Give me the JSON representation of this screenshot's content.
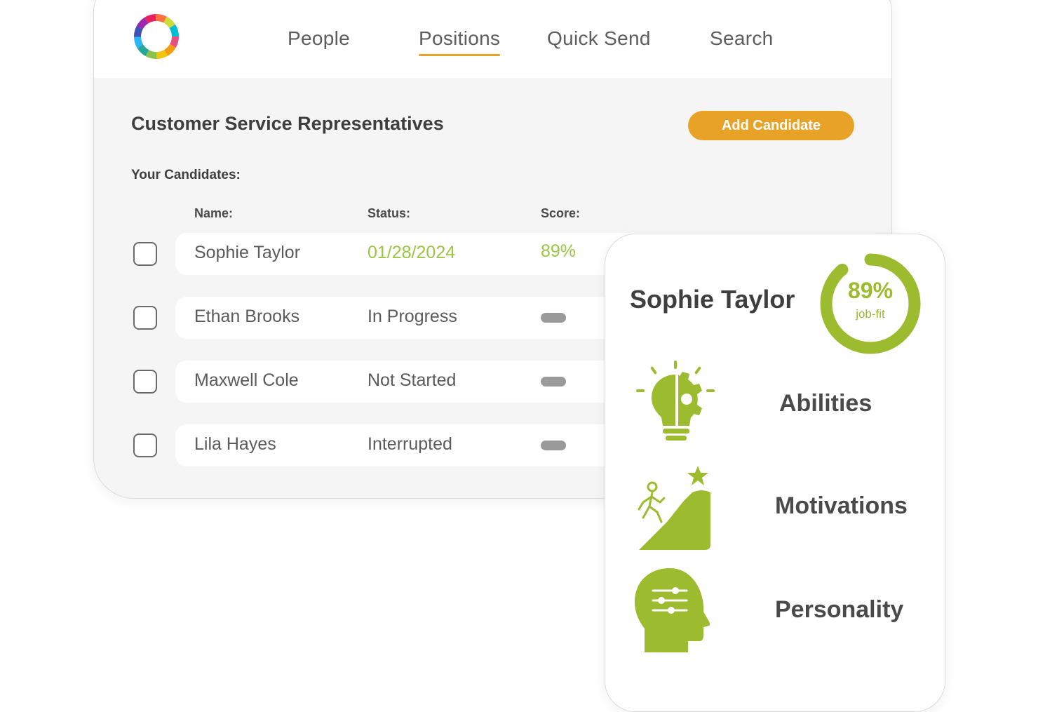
{
  "nav": {
    "items": [
      {
        "label": "People"
      },
      {
        "label": "Positions",
        "active": true
      },
      {
        "label": "Quick Send"
      },
      {
        "label": "Search"
      }
    ],
    "accent_color": "#e8a227"
  },
  "position": {
    "title": "Customer Service Representatives",
    "add_button_label": "Add Candidate"
  },
  "candidates": {
    "section_label": "Your Candidates:",
    "columns": {
      "name": "Name:",
      "status": "Status:",
      "score": "Score:"
    },
    "rows": [
      {
        "name": "Sophie Taylor",
        "status": "01/28/2024",
        "score": "89%",
        "checked": false
      },
      {
        "name": "Ethan Brooks",
        "status": "In Progress",
        "score": "",
        "checked": false
      },
      {
        "name": "Maxwell Cole",
        "status": "Not Started",
        "score": "",
        "checked": false
      },
      {
        "name": "Lila Hayes",
        "status": "Interrupted",
        "score": "",
        "checked": false
      }
    ]
  },
  "detail": {
    "name": "Sophie Taylor",
    "score_percent": "89%",
    "score_fraction": 0.89,
    "score_label": "job-fit",
    "accent_color": "#9cbb2f",
    "traits": [
      {
        "label": "Abilities",
        "icon": "lightbulb-gear-icon"
      },
      {
        "label": "Motivations",
        "icon": "climbing-person-star-icon"
      },
      {
        "label": "Personality",
        "icon": "head-sliders-icon"
      }
    ]
  }
}
